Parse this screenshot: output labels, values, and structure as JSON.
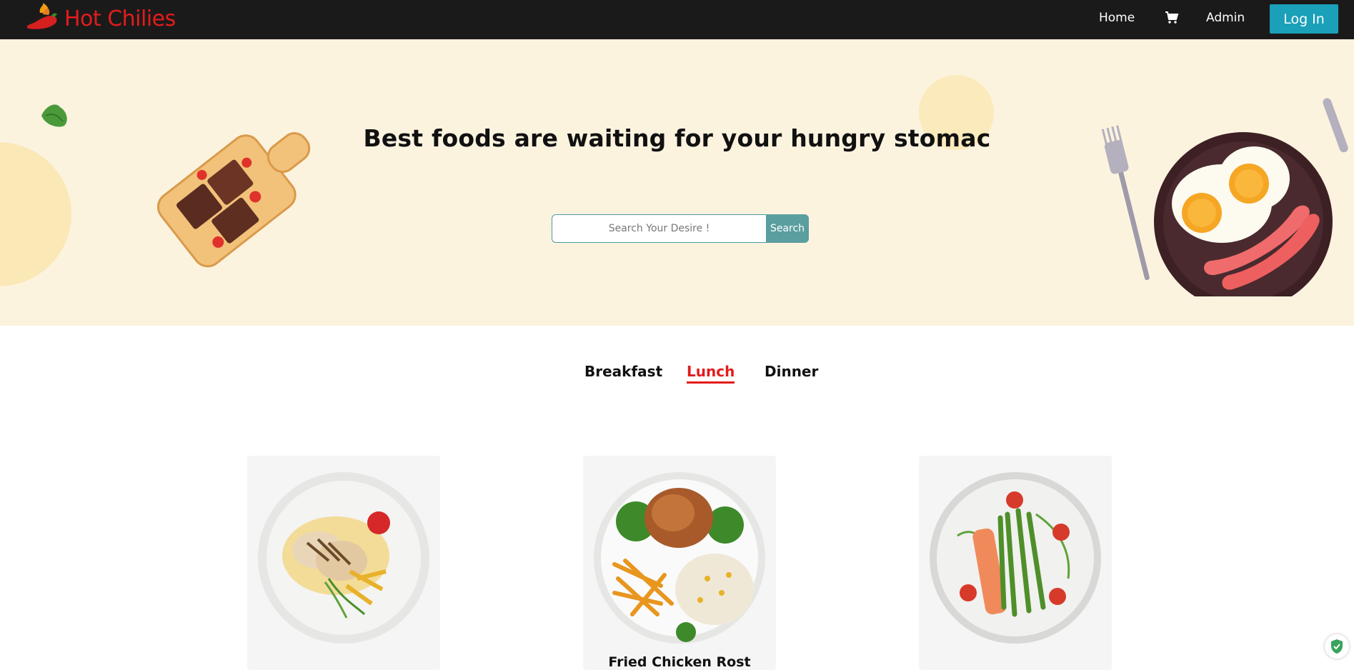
{
  "nav": {
    "brand": "Hot Chilies",
    "home": "Home",
    "cart_icon": "cart-icon",
    "admin": "Admin",
    "login": "Log In"
  },
  "hero": {
    "title": "Best foods are waiting for your hungry stomac",
    "search_placeholder": "Search Your Desire !",
    "search_button": "Search"
  },
  "tabs": [
    {
      "label": "Breakfast",
      "active": false
    },
    {
      "label": "Lunch",
      "active": true
    },
    {
      "label": "Dinner",
      "active": false
    }
  ],
  "cards": [
    {
      "title": "",
      "image": "grilled-chicken-plate"
    },
    {
      "title": "Fried Chicken Rost",
      "image": "chicken-fries-rice-plate"
    },
    {
      "title": "",
      "image": "salmon-asparagus-plate"
    }
  ],
  "colors": {
    "brand_red": "#e31c1c",
    "navbar": "#1b1a1a",
    "hero_bg": "#fcf3df",
    "login_button": "#1aa0b9",
    "search_button": "#5b9e9f"
  }
}
